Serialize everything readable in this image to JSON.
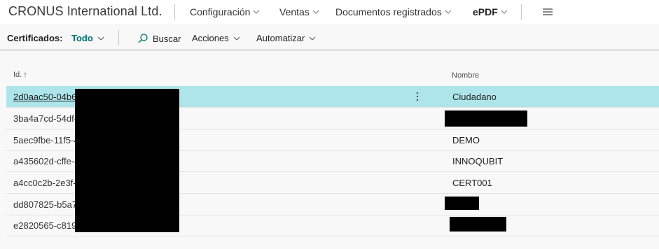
{
  "app": {
    "title": "CRONUS International Ltd."
  },
  "nav": {
    "items": [
      {
        "label": "Configuración"
      },
      {
        "label": "Ventas"
      },
      {
        "label": "Documentos registrados"
      },
      {
        "label": "ePDF"
      }
    ],
    "menu_icon": "hamburger-icon"
  },
  "actionbar": {
    "label": "Certificados:",
    "filter": "Todo",
    "search": "Buscar",
    "actions": "Acciones",
    "automate": "Automatizar"
  },
  "list": {
    "columns": {
      "id": "Id.",
      "id_sort": "↑",
      "name": "Nombre"
    },
    "rows": [
      {
        "id": "2d0aac50-04b6-",
        "name": "Ciudadano",
        "selected": true
      },
      {
        "id": "3ba4a7cd-54df-",
        "name": ""
      },
      {
        "id": "5aec9fbe-11f5-4",
        "name": "DEMO"
      },
      {
        "id": "a435602d-cffe-4",
        "name": "INNOQUBIT"
      },
      {
        "id": "a4cc0c2b-2e3f-4",
        "name": "CERT001"
      },
      {
        "id": "dd807825-b5a7",
        "name": ""
      },
      {
        "id": "e2820565-c819-",
        "name": ""
      }
    ],
    "row_menu": "⋮"
  },
  "colors": {
    "accent": "#00706e",
    "selected_row": "#aee5ea",
    "redaction": "#000000"
  }
}
